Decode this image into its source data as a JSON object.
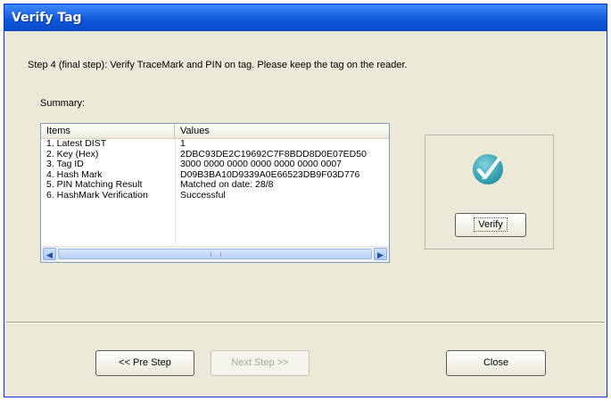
{
  "window": {
    "title": "Verify Tag"
  },
  "instructions": "Step 4 (final step): Verify TraceMark and PIN on tag. Please keep the tag on the reader.",
  "summary_label": "Summary:",
  "listview": {
    "columns": [
      "Items",
      "Values"
    ],
    "rows": [
      {
        "item": "1.   Latest DIST",
        "value": "1"
      },
      {
        "item": "2.   Key (Hex)",
        "value": "2DBC93DE2C19692C7F8BDD8D0E07ED50"
      },
      {
        "item": "3.   Tag ID",
        "value": "3000 0000 0000 0000 0000 0000 0007"
      },
      {
        "item": "4.   Hash Mark",
        "value": "D09B3BA10D9339A0E66523DB9F03D776"
      },
      {
        "item": "5.   PIN Matching Result",
        "value": "Matched on date: 28/8"
      },
      {
        "item": "6.   HashMark Verification",
        "value": "Successful"
      }
    ]
  },
  "verify_panel": {
    "icon": "checkmark-icon",
    "button_label": "Verify"
  },
  "buttons": {
    "pre_step": "<< Pre Step",
    "next_step": "Next Step >>",
    "close": "Close"
  },
  "colors": {
    "titlebar": "#0d56d8",
    "window_bg": "#ece9d8",
    "icon_bg": "#2fa3b5"
  }
}
